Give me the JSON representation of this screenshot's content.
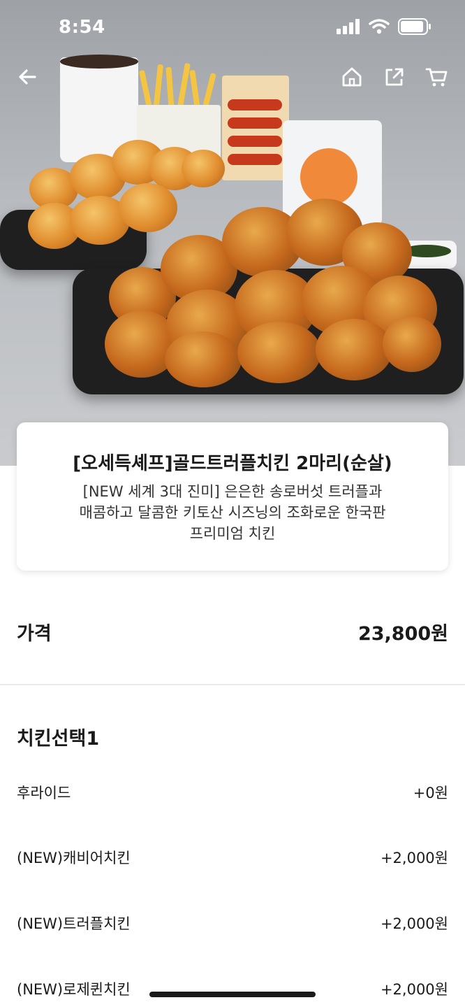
{
  "status_bar": {
    "time": "8:54"
  },
  "product": {
    "title": "[오세득셰프]골드트러플치킨 2마리(순살)",
    "description_lines": [
      "[NEW 세계 3대 진미] 은은한 송로버섯 트러플과",
      "매콤하고 달콤한 키토산 시즈닝의 조화로운 한국판",
      "프리미엄 치킨"
    ]
  },
  "price": {
    "label": "가격",
    "value": "23,800원"
  },
  "options": {
    "title": "치킨선택1",
    "items": [
      {
        "name": "후라이드",
        "price": "+0원"
      },
      {
        "name": "(NEW)캐비어치킨",
        "price": "+2,000원"
      },
      {
        "name": "(NEW)트러플치킨",
        "price": "+2,000원"
      },
      {
        "name": "(NEW)로제퀸치킨",
        "price": "+2,000원"
      }
    ]
  },
  "icons": [
    "back-arrow-icon",
    "home-icon",
    "share-icon",
    "cart-icon",
    "signal-icon",
    "wifi-icon",
    "battery-icon"
  ]
}
